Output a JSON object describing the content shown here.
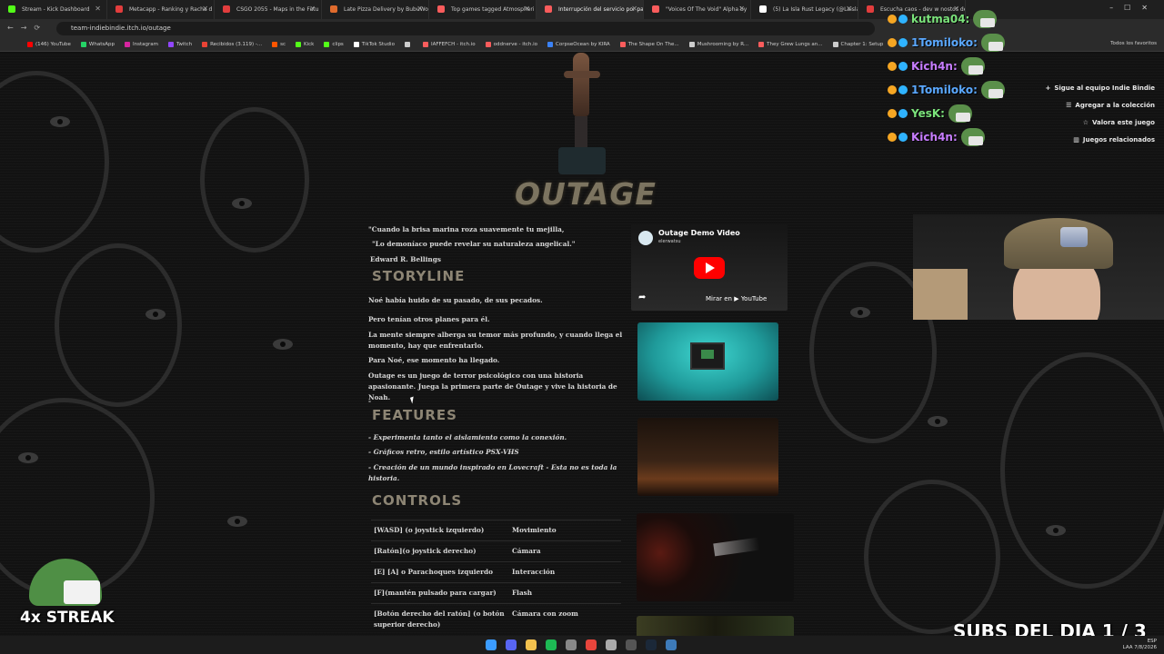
{
  "browser": {
    "tabs": [
      {
        "label": "Stream - Kick Dashboard",
        "color": "#53fc18"
      },
      {
        "label": "Metacapp - Ranking y Racha d",
        "color": "#e23d3d"
      },
      {
        "label": "CSGO 2055 - Maps in the Futu",
        "color": "#e23d3d"
      },
      {
        "label": "Late Pizza Delivery by BubuWo",
        "color": "#e06b2d"
      },
      {
        "label": "Top games tagged Atmospheri",
        "color": "#fa5c5c"
      },
      {
        "label": "Interrupción del servicio por pa",
        "color": "#fa5c5c",
        "active": true
      },
      {
        "label": "\"Voices Of The Void\" Alpha by",
        "color": "#fa5c5c"
      },
      {
        "label": "(5) La Isla Rust Legacy (@Laisla",
        "color": "#ffffff"
      },
      {
        "label": "Escucha caos - dev w nostos de",
        "color": "#e23d3d"
      }
    ],
    "url": "team-indiebindie.itch.io/outage",
    "bookmarks": [
      {
        "label": "(146) YouTube",
        "color": "#ff0000"
      },
      {
        "label": "WhatsApp",
        "color": "#25d366"
      },
      {
        "label": "Instagram",
        "color": "#d6249f"
      },
      {
        "label": "Twitch",
        "color": "#9146ff"
      },
      {
        "label": "Recibidos (3.119) -...",
        "color": "#ea4335"
      },
      {
        "label": "sc",
        "color": "#ff5500"
      },
      {
        "label": "Kick",
        "color": "#53fc18"
      },
      {
        "label": "clips",
        "color": "#53fc18"
      },
      {
        "label": "TikTok Studio",
        "color": "#ffffff"
      },
      {
        "label": "",
        "color": "#cccccc"
      },
      {
        "label": "IAFFEFCH - itch.io",
        "color": "#fa5c5c"
      },
      {
        "label": "oddnerve - itch.io",
        "color": "#fa5c5c"
      },
      {
        "label": "CorpseOcean by KIRA",
        "color": "#3b82f6"
      },
      {
        "label": "The Shape On The...",
        "color": "#fa5c5c"
      },
      {
        "label": "Mushrooming by R...",
        "color": "#cccccc"
      },
      {
        "label": "They Grew Lungs an...",
        "color": "#fa5c5c"
      },
      {
        "label": "Chapter 1: Setup",
        "color": "#cccccc"
      }
    ],
    "bookmarks_right": "Todos los favoritos"
  },
  "game": {
    "title": "OUTAGE",
    "quote_line1": "\"Cuando la brisa marina roza suavemente tu mejilla,",
    "quote_line2": "\"Lo demoníaco puede revelar su naturaleza angelical.\"",
    "quote_author": "Edward R. Bellings",
    "storyline_heading": "STORYLINE",
    "storyline": [
      "Noé había huido de su pasado, de sus pecados.",
      "Pero tenían otros planes para él.",
      "La mente siempre alberga su temor más profundo, y cuando llega el momento, hay que enfrentarlo.",
      "Para Noé, ese momento ha llegado.",
      "Outage es un juego de terror psicológico con una historia apasionante. Juega la primera parte de Outage y vive la historia de Noah.",
      "-"
    ],
    "features_heading": "FEATURES",
    "features": [
      "- Experimenta tanto el aislamiento como la conexión.",
      "- Gráficos retro, estilo artístico PSX-VHS",
      "- Creación de un mundo inspirado en Lovecraft - Esta no es toda la historia."
    ],
    "controls_heading": "CONTROLS",
    "controls": [
      {
        "key": "[WASD] (o joystick izquierdo)",
        "action": "Movimiento"
      },
      {
        "key": "[Ratón](o joystick derecho)",
        "action": "Cámara"
      },
      {
        "key": "[E] [A] o Parachoques izquierdo",
        "action": "Interacción"
      },
      {
        "key": "[F](mantén pulsado para cargar)",
        "action": "Flash"
      },
      {
        "key": "[Botón derecho del ratón] (o botón superior derecho)",
        "action": "Cámara con zoom"
      }
    ]
  },
  "video": {
    "title": "Outage Demo Video",
    "channel": "elerwatsu",
    "watch_label": "Mirar en ▶ YouTube"
  },
  "itch_actions": [
    {
      "label": "Sigue al equipo Indie Bindie",
      "icon": "+"
    },
    {
      "label": "Agregar a la colección",
      "icon": "☰"
    },
    {
      "label": "Valora este juego",
      "icon": "☆"
    },
    {
      "label": "Juegos relacionados",
      "icon": "▥"
    }
  ],
  "stream_chat": [
    {
      "name": "kutma04:",
      "color": "#7be37b"
    },
    {
      "name": "1Tomiloko:",
      "color": "#5aa8ff"
    },
    {
      "name": "Kich4n:",
      "color": "#c77dff"
    },
    {
      "name": "1Tomiloko:",
      "color": "#5aa8ff"
    },
    {
      "name": "YesK:",
      "color": "#7be37b"
    },
    {
      "name": "Kich4n:",
      "color": "#c77dff"
    }
  ],
  "overlay": {
    "streak": "4x STREAK",
    "subs": "SUBS DEL DIA 1 / 3"
  },
  "taskbar": {
    "lang": "ESP",
    "lang2": "LAA",
    "time": "",
    "date": "7/8/2026"
  }
}
